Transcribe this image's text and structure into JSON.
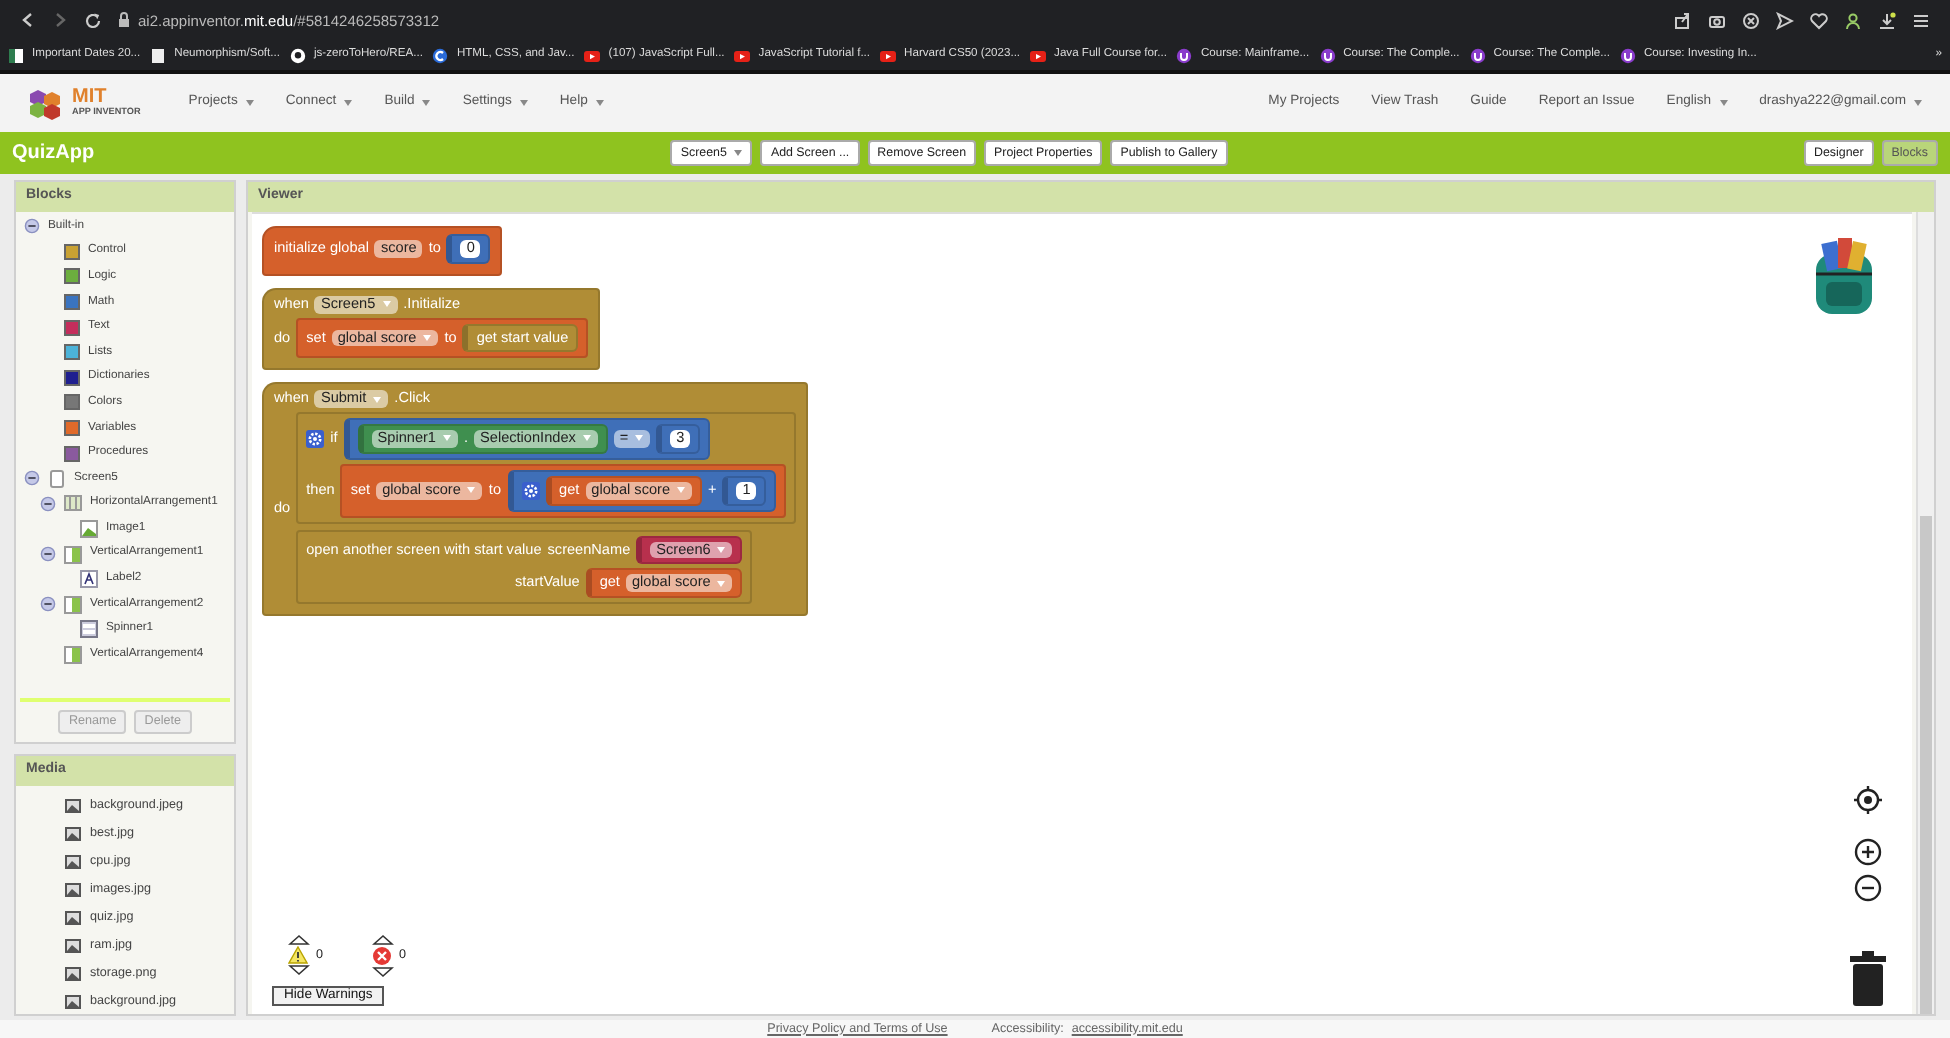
{
  "browser": {
    "url": "ai2.appinventor.**mit.edu**/#5814246258573312",
    "bookmarks": [
      {
        "kind": "calendar",
        "label": "Important Dates 20..."
      },
      {
        "kind": "page",
        "label": "Neumorphism/Soft..."
      },
      {
        "kind": "github",
        "label": "js-zeroToHero/REA..."
      },
      {
        "kind": "letter",
        "label": "HTML, CSS, and Jav..."
      },
      {
        "kind": "video",
        "label": "(107) JavaScript Full..."
      },
      {
        "kind": "video",
        "label": "JavaScript Tutorial f..."
      },
      {
        "kind": "video",
        "label": "Harvard CS50 (2023..."
      },
      {
        "kind": "video",
        "label": "Java Full Course for..."
      },
      {
        "kind": "course",
        "label": "Course: Mainframe..."
      },
      {
        "kind": "course",
        "label": "Course: The Comple..."
      },
      {
        "kind": "course",
        "label": "Course: The Comple..."
      },
      {
        "kind": "course",
        "label": "Course: Investing In..."
      }
    ],
    "more": "»"
  },
  "app_header": {
    "logo": {
      "title": "MIT",
      "subtitle": "APP INVENTOR"
    },
    "menus": [
      {
        "label": "Projects",
        "dropdown": true
      },
      {
        "label": "Connect",
        "dropdown": true
      },
      {
        "label": "Build",
        "dropdown": true
      },
      {
        "label": "Settings",
        "dropdown": true
      },
      {
        "label": "Help",
        "dropdown": true
      }
    ],
    "links": [
      {
        "label": "My Projects",
        "dropdown": false
      },
      {
        "label": "View Trash",
        "dropdown": false
      },
      {
        "label": "Guide",
        "dropdown": false
      },
      {
        "label": "Report an Issue",
        "dropdown": false
      },
      {
        "label": "English",
        "dropdown": true
      },
      {
        "label": "drashya222@gmail.com",
        "dropdown": true
      }
    ]
  },
  "toolbar": {
    "project": "QuizApp",
    "buttons": [
      {
        "label": "Screen5",
        "dropdown": true
      },
      {
        "label": "Add Screen ...",
        "dropdown": false
      },
      {
        "label": "Remove Screen",
        "dropdown": false
      },
      {
        "label": "Project Properties",
        "dropdown": false
      },
      {
        "label": "Publish to Gallery",
        "dropdown": false
      }
    ],
    "views": [
      {
        "label": "Designer",
        "selected": false
      },
      {
        "label": "Blocks",
        "selected": true
      }
    ]
  },
  "blocks_panel": {
    "title": "Blocks",
    "tree": [
      {
        "label": "Built-in",
        "kind": "folder",
        "expanded": true,
        "children": [
          {
            "label": "Control",
            "color": "#c9a233"
          },
          {
            "label": "Logic",
            "color": "#6cae3e"
          },
          {
            "label": "Math",
            "color": "#3a74c0"
          },
          {
            "label": "Text",
            "color": "#c42d5c"
          },
          {
            "label": "Lists",
            "color": "#4cb3d9"
          },
          {
            "label": "Dictionaries",
            "color": "#1f1f8f"
          },
          {
            "label": "Colors",
            "color": "#777777"
          },
          {
            "label": "Variables",
            "color": "#e06a2a"
          },
          {
            "label": "Procedures",
            "color": "#8a5a9e"
          }
        ]
      },
      {
        "label": "Screen5",
        "kind": "screen",
        "expanded": true,
        "children": [
          {
            "label": "HorizontalArrangement1",
            "kind": "horizontal",
            "expanded": true,
            "children": [
              {
                "label": "Image1",
                "kind": "image"
              }
            ]
          },
          {
            "label": "VerticalArrangement1",
            "kind": "vertical",
            "expanded": true,
            "children": [
              {
                "label": "Label2",
                "kind": "label"
              }
            ]
          },
          {
            "label": "VerticalArrangement2",
            "kind": "vertical",
            "expanded": true,
            "children": [
              {
                "label": "Spinner1",
                "kind": "spinner"
              }
            ]
          },
          {
            "label": "VerticalArrangement4",
            "kind": "vertical"
          }
        ]
      }
    ],
    "buttons": [
      {
        "label": "Rename",
        "disabled": true
      },
      {
        "label": "Delete",
        "disabled": true
      }
    ]
  },
  "media_panel": {
    "title": "Media",
    "files": [
      "background.jpeg",
      "best.jpg",
      "cpu.jpg",
      "images.jpg",
      "quiz.jpg",
      "ram.jpg",
      "storage.png",
      "background.jpg"
    ]
  },
  "viewer": {
    "title": "Viewer",
    "blocks": [
      {
        "kind": "event",
        "color": "#d5602b",
        "lines": [
          {
            "items": [
              {
                "kind": "label",
                "text": "initialize global"
              },
              {
                "kind": "field",
                "text": "score"
              },
              {
                "kind": "label",
                "text": "to"
              },
              {
                "kind": "block",
                "block": {
                  "kind": "value",
                  "color": "#3f6fb8",
                  "lines": [
                    {
                      "items": [
                        {
                          "kind": "number",
                          "text": "0"
                        }
                      ]
                    }
                  ]
                }
              }
            ]
          }
        ]
      },
      {
        "kind": "event",
        "color": "#b08d36",
        "lines": [
          {
            "items": [
              {
                "kind": "label",
                "text": "when"
              },
              {
                "kind": "dropdown",
                "text": "Screen5"
              },
              {
                "kind": "label",
                "text": ".Initialize"
              }
            ]
          },
          {
            "items": [
              {
                "kind": "label",
                "text": "do"
              },
              {
                "kind": "block",
                "block": {
                  "kind": "statement",
                  "color": "#d5602b",
                  "lines": [
                    {
                      "items": [
                        {
                          "kind": "label",
                          "text": "set"
                        },
                        {
                          "kind": "dropdown",
                          "text": "global score"
                        },
                        {
                          "kind": "label",
                          "text": "to"
                        },
                        {
                          "kind": "block",
                          "block": {
                            "kind": "value",
                            "color": "#b08d36",
                            "lines": [
                              {
                                "items": [
                                  {
                                    "kind": "label",
                                    "text": "get start value"
                                  }
                                ]
                              }
                            ]
                          }
                        }
                      ]
                    }
                  ]
                }
              }
            ]
          }
        ]
      },
      {
        "kind": "event",
        "color": "#b08d36",
        "lines": [
          {
            "items": [
              {
                "kind": "label",
                "text": "when"
              },
              {
                "kind": "dropdown",
                "text": "Submit"
              },
              {
                "kind": "label",
                "text": ".Click"
              }
            ]
          },
          {
            "items": [
              {
                "kind": "label",
                "text": "do"
              },
              {
                "kind": "stack",
                "blocks": [
                  {
                    "kind": "statement",
                    "color": "#b08d36",
                    "lines": [
                      {
                        "items": [
                          {
                            "kind": "gear"
                          },
                          {
                            "kind": "label",
                            "text": "if"
                          },
                          {
                            "kind": "block",
                            "block": {
                              "kind": "value",
                              "color": "#3f6fb8",
                              "lines": [
                                {
                                  "items": [
                                    {
                                      "kind": "block",
                                      "block": {
                                        "kind": "value",
                                        "color": "#3f8f4f",
                                        "lines": [
                                          {
                                            "items": [
                                              {
                                                "kind": "dropdown",
                                                "text": "Spinner1"
                                              },
                                              {
                                                "kind": "label",
                                                "text": "."
                                              },
                                              {
                                                "kind": "dropdown",
                                                "text": "SelectionIndex"
                                              }
                                            ]
                                          }
                                        ]
                                      }
                                    },
                                    {
                                      "kind": "dropdown",
                                      "text": "="
                                    },
                                    {
                                      "kind": "block",
                                      "block": {
                                        "kind": "value",
                                        "color": "#3f6fb8",
                                        "lines": [
                                          {
                                            "items": [
                                              {
                                                "kind": "number",
                                                "text": "3"
                                              }
                                            ]
                                          }
                                        ]
                                      }
                                    }
                                  ]
                                }
                              ]
                            }
                          }
                        ]
                      },
                      {
                        "items": [
                          {
                            "kind": "label",
                            "text": "then"
                          },
                          {
                            "kind": "block",
                            "block": {
                              "kind": "statement",
                              "color": "#d5602b",
                              "lines": [
                                {
                                  "items": [
                                    {
                                      "kind": "label",
                                      "text": "set"
                                    },
                                    {
                                      "kind": "dropdown",
                                      "text": "global score"
                                    },
                                    {
                                      "kind": "label",
                                      "text": "to"
                                    },
                                    {
                                      "kind": "block",
                                      "block": {
                                        "kind": "value",
                                        "color": "#3f6fb8",
                                        "lines": [
                                          {
                                            "items": [
                                              {
                                                "kind": "gear"
                                              },
                                              {
                                                "kind": "block",
                                                "block": {
                                                  "kind": "value",
                                                  "color": "#d5602b",
                                                  "lines": [
                                                    {
                                                      "items": [
                                                        {
                                                          "kind": "label",
                                                          "text": "get"
                                                        },
                                                        {
                                                          "kind": "dropdown",
                                                          "text": "global score"
                                                        }
                                                      ]
                                                    }
                                                  ]
                                                }
                                              },
                                              {
                                                "kind": "label",
                                                "text": "+"
                                              },
                                              {
                                                "kind": "block",
                                                "block": {
                                                  "kind": "value",
                                                  "color": "#3f6fb8",
                                                  "lines": [
                                                    {
                                                      "items": [
                                                        {
                                                          "kind": "number",
                                                          "text": "1"
                                                        }
                                                      ]
                                                    }
                                                  ]
                                                }
                                              }
                                            ]
                                          }
                                        ]
                                      }
                                    }
                                  ]
                                }
                              ]
                            }
                          }
                        ]
                      }
                    ]
                  },
                  {
                    "kind": "call",
                    "color": "#b08d36",
                    "lines": [
                      {
                        "items": [
                          {
                            "kind": "label",
                            "text": "open another screen with start value"
                          },
                          {
                            "kind": "label",
                            "text": "screenName"
                          },
                          {
                            "kind": "block",
                            "block": {
                              "kind": "value",
                              "color": "#b8304d",
                              "lines": [
                                {
                                  "items": [
                                    {
                                      "kind": "dropdown",
                                      "text": "Screen6"
                                    }
                                  ]
                                }
                              ]
                            }
                          }
                        ]
                      },
                      {
                        "items": [
                          {
                            "kind": "label",
                            "text": "startValue"
                          },
                          {
                            "kind": "block",
                            "block": {
                              "kind": "value",
                              "color": "#d5602b",
                              "lines": [
                                {
                                  "items": [
                                    {
                                      "kind": "label",
                                      "text": "get"
                                    },
                                    {
                                      "kind": "dropdown",
                                      "text": "global score"
                                    }
                                  ]
                                }
                              ]
                            }
                          }
                        ]
                      }
                    ]
                  }
                ]
              }
            ]
          }
        ]
      }
    ],
    "warnings": {
      "warning_count": "0",
      "error_count": "0",
      "button": "Hide Warnings"
    }
  },
  "footer": {
    "privacy": "Privacy Policy and Terms of Use",
    "accessibility_label": "Accessibility:",
    "accessibility_link": "accessibility.mit.edu"
  }
}
